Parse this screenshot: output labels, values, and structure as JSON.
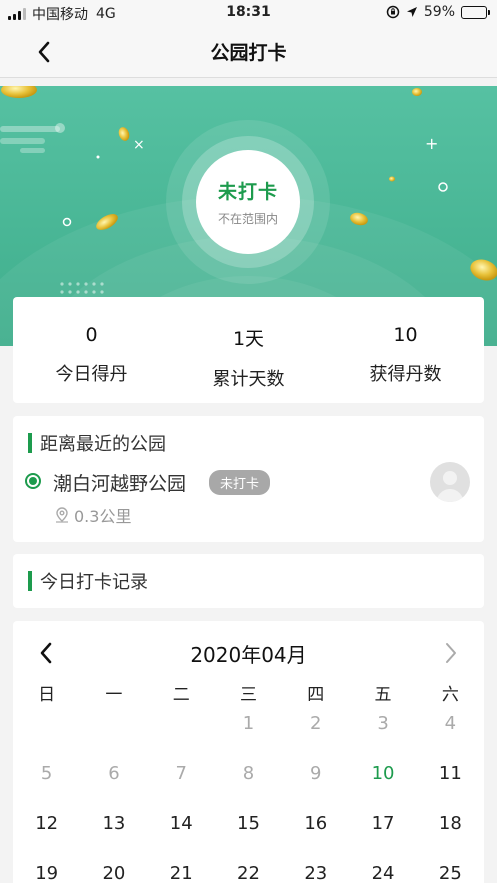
{
  "status_bar": {
    "carrier": "中国移动",
    "network": "4G",
    "time": "18:31",
    "battery_percent_text": "59%",
    "battery_level": 0.59
  },
  "nav": {
    "title": "公园打卡",
    "back_icon": "chevron-left-icon"
  },
  "hero": {
    "checkin_label": "未打卡",
    "checkin_status": "不在范围内",
    "background_color": "#5cc0a0"
  },
  "stats": [
    {
      "value": "0",
      "label": "今日得丹"
    },
    {
      "value": "1天",
      "label": "累计天数"
    },
    {
      "value": "10",
      "label": "获得丹数"
    }
  ],
  "nearest_park": {
    "section_title": "距离最近的公园",
    "park_name": "潮白河越野公园",
    "badge": "未打卡",
    "distance": "0.3公里"
  },
  "today_record": {
    "section_title": "今日打卡记录"
  },
  "calendar": {
    "month_label": "2020年04月",
    "weekdays": [
      "日",
      "一",
      "二",
      "三",
      "四",
      "五",
      "六"
    ],
    "weeks": [
      [
        {
          "d": "",
          "muted": true
        },
        {
          "d": "",
          "muted": true
        },
        {
          "d": "",
          "muted": true
        },
        {
          "d": "1",
          "muted": true
        },
        {
          "d": "2",
          "muted": true
        },
        {
          "d": "3",
          "muted": true
        },
        {
          "d": "4",
          "muted": true
        }
      ],
      [
        {
          "d": "5",
          "muted": true
        },
        {
          "d": "6",
          "muted": true
        },
        {
          "d": "7",
          "muted": true
        },
        {
          "d": "8",
          "muted": true
        },
        {
          "d": "9",
          "muted": true
        },
        {
          "d": "10",
          "today": true
        },
        {
          "d": "11"
        }
      ],
      [
        {
          "d": "12"
        },
        {
          "d": "13"
        },
        {
          "d": "14"
        },
        {
          "d": "15"
        },
        {
          "d": "16"
        },
        {
          "d": "17"
        },
        {
          "d": "18"
        }
      ],
      [
        {
          "d": "19"
        },
        {
          "d": "20"
        },
        {
          "d": "21"
        },
        {
          "d": "22"
        },
        {
          "d": "23"
        },
        {
          "d": "24"
        },
        {
          "d": "25"
        }
      ]
    ],
    "accent_color": "#1d9b4d"
  }
}
